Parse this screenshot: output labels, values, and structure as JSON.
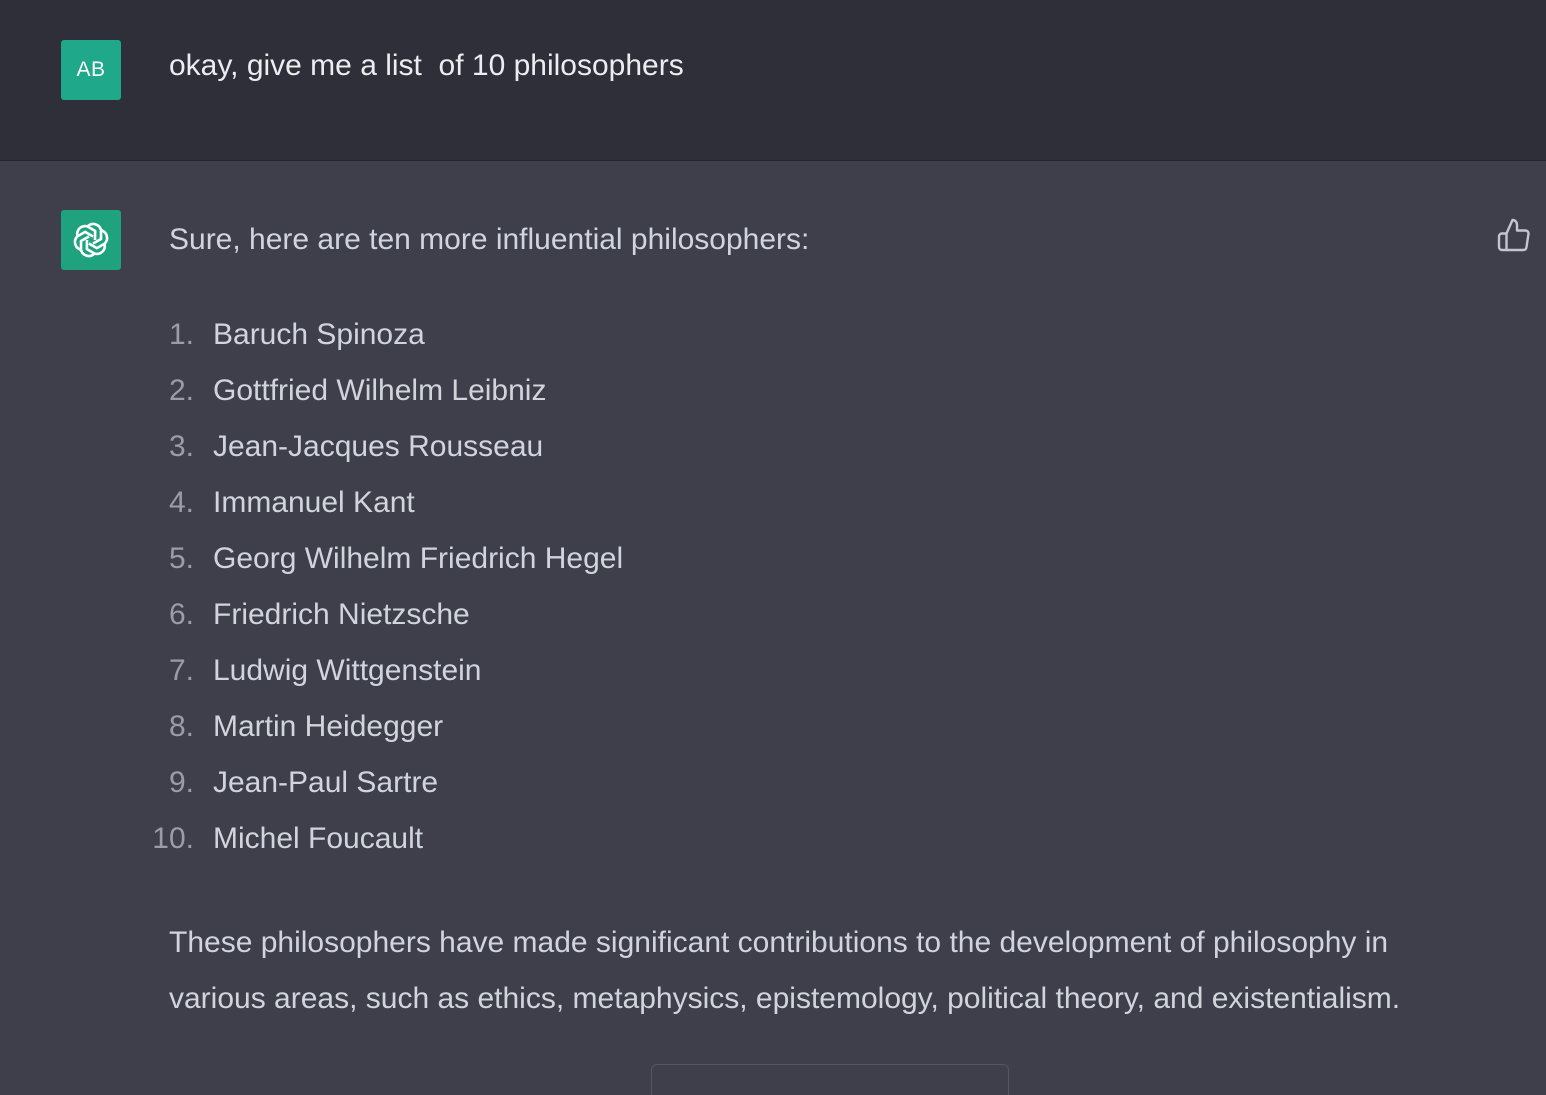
{
  "user_message": {
    "avatar_initials": "AB",
    "text": "okay, give me a list  of 10 philosophers"
  },
  "assistant_message": {
    "avatar_icon": "openai-logo-icon",
    "intro": "Sure, here are ten more influential philosophers:",
    "items": [
      {
        "num": "1.",
        "name": "Baruch Spinoza"
      },
      {
        "num": "2.",
        "name": "Gottfried Wilhelm Leibniz"
      },
      {
        "num": "3.",
        "name": "Jean-Jacques Rousseau"
      },
      {
        "num": "4.",
        "name": "Immanuel Kant"
      },
      {
        "num": "5.",
        "name": "Georg Wilhelm Friedrich Hegel"
      },
      {
        "num": "6.",
        "name": "Friedrich Nietzsche"
      },
      {
        "num": "7.",
        "name": "Ludwig Wittgenstein"
      },
      {
        "num": "8.",
        "name": "Martin Heidegger"
      },
      {
        "num": "9.",
        "name": "Jean-Paul Sartre"
      },
      {
        "num": "10.",
        "name": "Michel Foucault"
      }
    ],
    "outro": "These philosophers have made significant contributions to the development of philosophy in various areas, such as ethics, metaphysics, epistemology, political theory, and existentialism.",
    "feedback_icon": "thumbs-up-icon"
  },
  "colors": {
    "user_row_bg": "#2e2f38",
    "assistant_row_bg": "#3e3f4b",
    "avatar_bg": "#1fa37f",
    "text": "#d1d5db"
  }
}
